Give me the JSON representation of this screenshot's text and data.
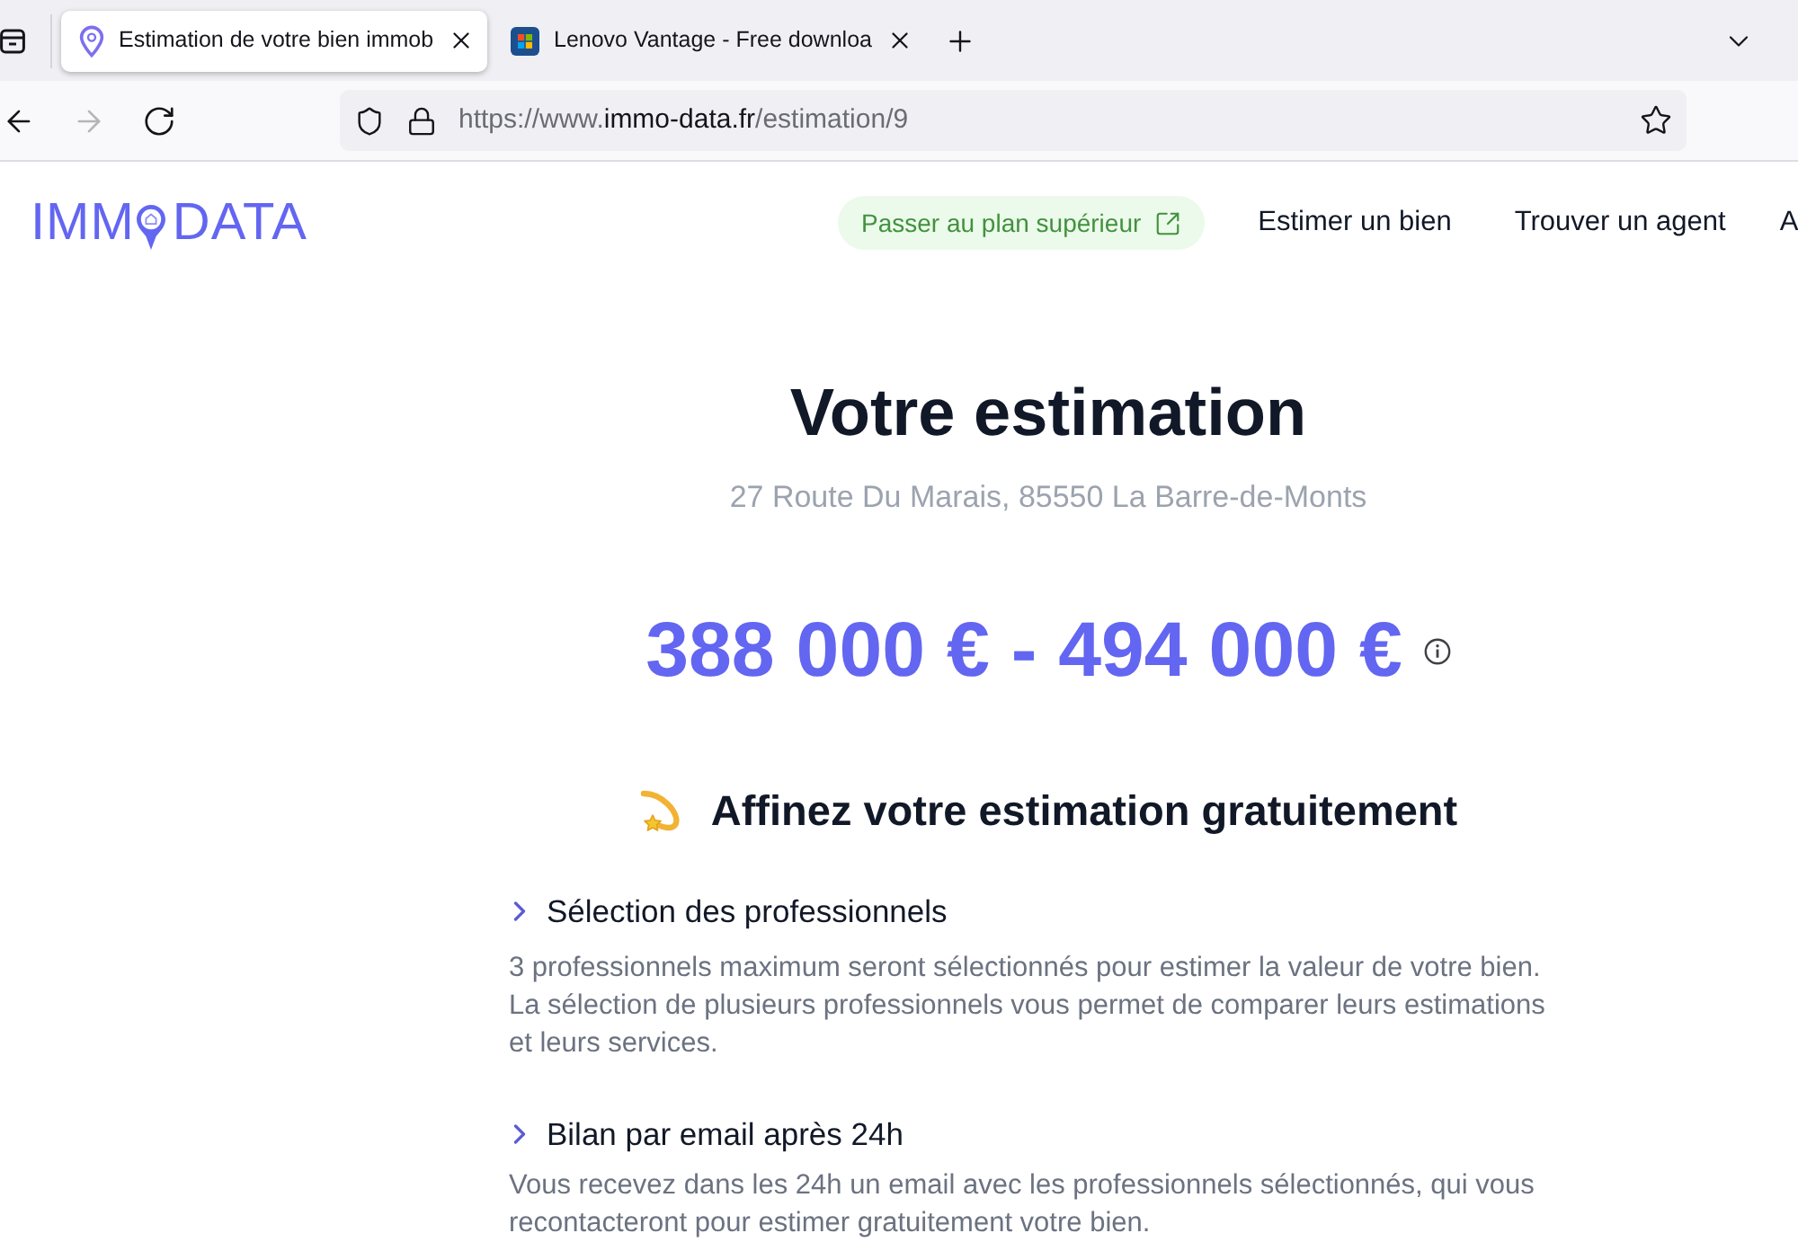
{
  "browser": {
    "tabs": [
      {
        "title": "Estimation de votre bien immob",
        "selected": true,
        "kind": "pin"
      },
      {
        "title": "Lenovo Vantage - Free downloa",
        "selected": false,
        "kind": "tile"
      }
    ],
    "navigation": {
      "back": {
        "disabled": false
      },
      "forward": {
        "disabled": true
      }
    },
    "address_bar": {
      "prefix": "https://www.",
      "domain": "immo-data.fr",
      "path": "/estimation/9"
    }
  },
  "site_header": {
    "logo": {
      "left": "IMM",
      "right": "DATA"
    },
    "upgrade_button": "Passer au plan supérieur",
    "nav_links": [
      "Estimer un bien",
      "Trouver un agent",
      "A"
    ]
  },
  "estimate": {
    "title": "Votre estimation",
    "address": "27 Route Du Marais, 85550 La Barre-de-Monts",
    "price_range": "388 000 € - 494 000 €"
  },
  "refine": {
    "title": "Affinez votre estimation gratuitement",
    "sections": [
      {
        "title": "Sélection des professionnels",
        "text": "3 professionnels maximum seront sélectionnés pour estimer la valeur de votre bien. La sélection de plusieurs professionnels vous permet de comparer leurs estimations et leurs services."
      },
      {
        "title": "Bilan par email après 24h",
        "text": "Vous recevez dans les 24h un email avec les professionnels sélectionnés, qui vous recontacteront pour estimer gratuitement votre bien."
      }
    ]
  }
}
